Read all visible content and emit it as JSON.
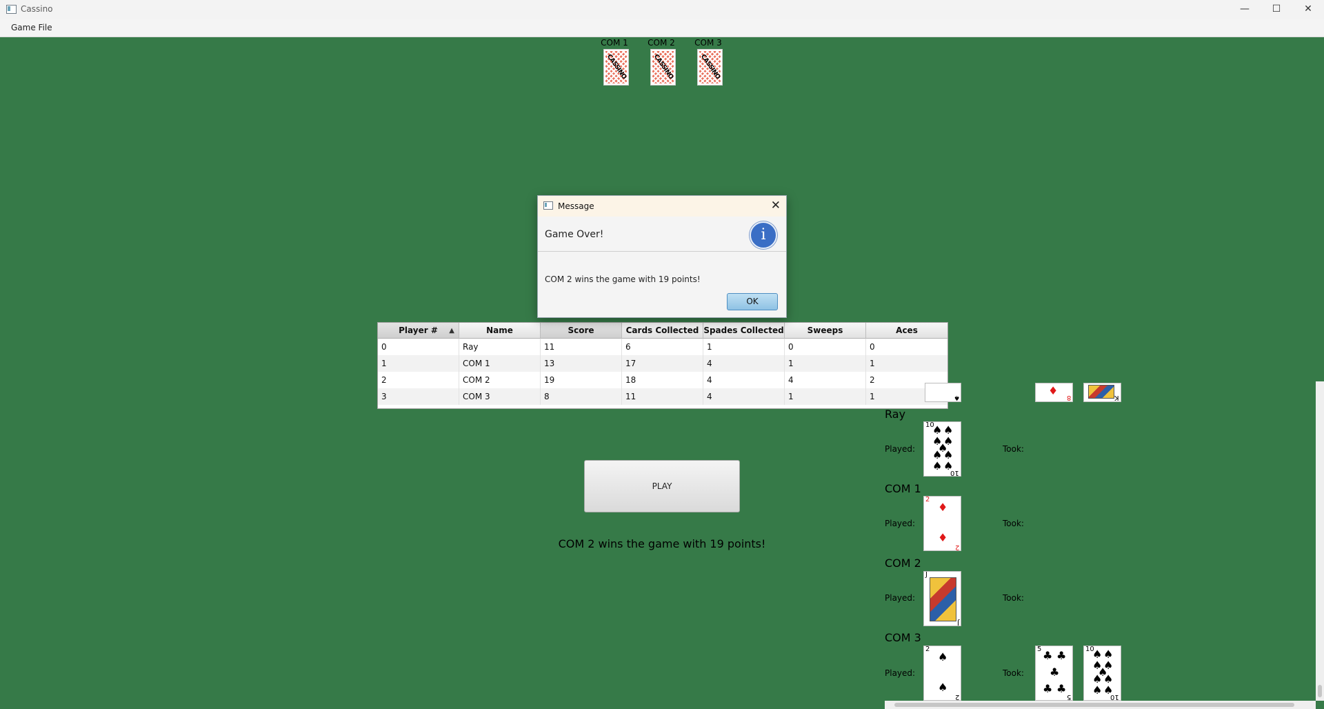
{
  "window": {
    "title": "Cassino",
    "minimize": "—",
    "maximize": "☐",
    "close": "✕"
  },
  "menu": {
    "items": [
      "Game File"
    ]
  },
  "opponents": [
    {
      "label": "COM 1",
      "card_text": "CASSINO"
    },
    {
      "label": "COM 2",
      "card_text": "CASSINO"
    },
    {
      "label": "COM 3",
      "card_text": "CASSINO"
    }
  ],
  "dialog": {
    "title": "Message",
    "header": "Game Over!",
    "content": "COM 2 wins the game with 19 points!",
    "ok_label": "OK",
    "icon_glyph": "i"
  },
  "table": {
    "columns": [
      "Player #",
      "Name",
      "Score",
      "Cards Collected",
      "Spades Collected",
      "Sweeps",
      "Aces"
    ],
    "sorted_column": "Player #",
    "sort_arrow": "▲",
    "rows": [
      [
        "0",
        "Ray",
        "11",
        "6",
        "1",
        "0",
        "0"
      ],
      [
        "1",
        "COM 1",
        "13",
        "17",
        "4",
        "1",
        "1"
      ],
      [
        "2",
        "COM 2",
        "19",
        "18",
        "4",
        "4",
        "2"
      ],
      [
        "3",
        "COM 3",
        "8",
        "11",
        "4",
        "1",
        "1"
      ]
    ]
  },
  "play_button": "PLAY",
  "status_message": "COM 2 wins the game with 19 points!",
  "history": {
    "played_label": "Played:",
    "took_label": "Took:",
    "players": [
      {
        "name": "Ray",
        "played": "10♠",
        "played_rank": "10",
        "played_suit": "♠"
      },
      {
        "name": "COM 1",
        "played": "2♦",
        "played_rank": "2",
        "played_suit": "♦"
      },
      {
        "name": "COM 2",
        "played": "J♠",
        "played_rank": "J",
        "played_suit": "♠"
      },
      {
        "name": "COM 3",
        "played": "2♠",
        "played_rank": "2",
        "played_suit": "♠",
        "took": [
          {
            "rank": "5",
            "suit": "♣"
          },
          {
            "rank": "10",
            "suit": "♠"
          }
        ]
      }
    ],
    "partial_top_cards": [
      {
        "rank": "A",
        "suit": "♠"
      },
      {
        "rank": "8",
        "suit": "♦"
      },
      {
        "rank": "K",
        "suit": "♣"
      }
    ]
  },
  "colors": {
    "felt": "#367a48",
    "ok_button": "#8fc2e4",
    "info_icon": "#3a6ec5"
  }
}
